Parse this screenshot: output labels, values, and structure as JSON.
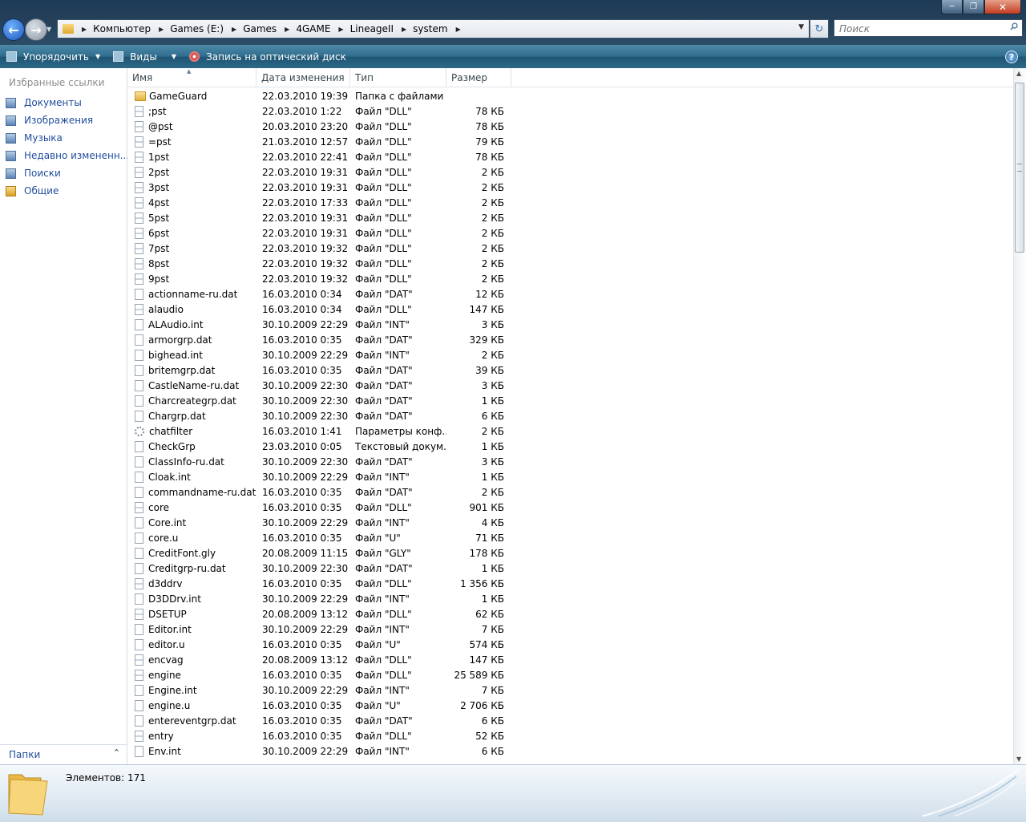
{
  "address": {
    "crumbs": [
      "Компьютер",
      "Games (E:)",
      "Games",
      "4GAME",
      "LineageII",
      "system"
    ]
  },
  "search": {
    "placeholder": "Поиск"
  },
  "toolbar": {
    "organize_label": "Упорядочить",
    "views_label": "Виды",
    "burn_label": "Запись на оптический диск"
  },
  "sidebar": {
    "title": "Избранные ссылки",
    "items": [
      {
        "label": "Документы",
        "icon": "documents-icon"
      },
      {
        "label": "Изображения",
        "icon": "pictures-icon"
      },
      {
        "label": "Музыка",
        "icon": "music-icon"
      },
      {
        "label": "Недавно измененн...",
        "icon": "recent-icon"
      },
      {
        "label": "Поиски",
        "icon": "searches-icon"
      },
      {
        "label": "Общие",
        "icon": "public-folder-icon"
      }
    ],
    "folders_label": "Папки"
  },
  "columns": {
    "name": "Имя",
    "date": "Дата изменения",
    "type": "Тип",
    "size": "Размер"
  },
  "files": [
    {
      "name": "GameGuard",
      "date": "22.03.2010 19:39",
      "type": "Папка с файлами",
      "size": "",
      "icon": "folder"
    },
    {
      "name": ";pst",
      "date": "22.03.2010 1:22",
      "type": "Файл \"DLL\"",
      "size": "78 КБ",
      "icon": "dll"
    },
    {
      "name": "@pst",
      "date": "20.03.2010 23:20",
      "type": "Файл \"DLL\"",
      "size": "78 КБ",
      "icon": "dll"
    },
    {
      "name": "=pst",
      "date": "21.03.2010 12:57",
      "type": "Файл \"DLL\"",
      "size": "79 КБ",
      "icon": "dll"
    },
    {
      "name": "1pst",
      "date": "22.03.2010 22:41",
      "type": "Файл \"DLL\"",
      "size": "78 КБ",
      "icon": "dll"
    },
    {
      "name": "2pst",
      "date": "22.03.2010 19:31",
      "type": "Файл \"DLL\"",
      "size": "2 КБ",
      "icon": "dll"
    },
    {
      "name": "3pst",
      "date": "22.03.2010 19:31",
      "type": "Файл \"DLL\"",
      "size": "2 КБ",
      "icon": "dll"
    },
    {
      "name": "4pst",
      "date": "22.03.2010 17:33",
      "type": "Файл \"DLL\"",
      "size": "2 КБ",
      "icon": "dll"
    },
    {
      "name": "5pst",
      "date": "22.03.2010 19:31",
      "type": "Файл \"DLL\"",
      "size": "2 КБ",
      "icon": "dll"
    },
    {
      "name": "6pst",
      "date": "22.03.2010 19:31",
      "type": "Файл \"DLL\"",
      "size": "2 КБ",
      "icon": "dll"
    },
    {
      "name": "7pst",
      "date": "22.03.2010 19:32",
      "type": "Файл \"DLL\"",
      "size": "2 КБ",
      "icon": "dll"
    },
    {
      "name": "8pst",
      "date": "22.03.2010 19:32",
      "type": "Файл \"DLL\"",
      "size": "2 КБ",
      "icon": "dll"
    },
    {
      "name": "9pst",
      "date": "22.03.2010 19:32",
      "type": "Файл \"DLL\"",
      "size": "2 КБ",
      "icon": "dll"
    },
    {
      "name": "actionname-ru.dat",
      "date": "16.03.2010 0:34",
      "type": "Файл \"DAT\"",
      "size": "12 КБ",
      "icon": "file"
    },
    {
      "name": "alaudio",
      "date": "16.03.2010 0:34",
      "type": "Файл \"DLL\"",
      "size": "147 КБ",
      "icon": "dll"
    },
    {
      "name": "ALAudio.int",
      "date": "30.10.2009 22:29",
      "type": "Файл \"INT\"",
      "size": "3 КБ",
      "icon": "file"
    },
    {
      "name": "armorgrp.dat",
      "date": "16.03.2010 0:35",
      "type": "Файл \"DAT\"",
      "size": "329 КБ",
      "icon": "file"
    },
    {
      "name": "bighead.int",
      "date": "30.10.2009 22:29",
      "type": "Файл \"INT\"",
      "size": "2 КБ",
      "icon": "file"
    },
    {
      "name": "britemgrp.dat",
      "date": "16.03.2010 0:35",
      "type": "Файл \"DAT\"",
      "size": "39 КБ",
      "icon": "file"
    },
    {
      "name": "CastleName-ru.dat",
      "date": "30.10.2009 22:30",
      "type": "Файл \"DAT\"",
      "size": "3 КБ",
      "icon": "file"
    },
    {
      "name": "Charcreategrp.dat",
      "date": "30.10.2009 22:30",
      "type": "Файл \"DAT\"",
      "size": "1 КБ",
      "icon": "file"
    },
    {
      "name": "Chargrp.dat",
      "date": "30.10.2009 22:30",
      "type": "Файл \"DAT\"",
      "size": "6 КБ",
      "icon": "file"
    },
    {
      "name": "chatfilter",
      "date": "16.03.2010 1:41",
      "type": "Параметры конф...",
      "size": "2 КБ",
      "icon": "cfg"
    },
    {
      "name": "CheckGrp",
      "date": "23.03.2010 0:05",
      "type": "Текстовый докум...",
      "size": "1 КБ",
      "icon": "file"
    },
    {
      "name": "ClassInfo-ru.dat",
      "date": "30.10.2009 22:30",
      "type": "Файл \"DAT\"",
      "size": "3 КБ",
      "icon": "file"
    },
    {
      "name": "Cloak.int",
      "date": "30.10.2009 22:29",
      "type": "Файл \"INT\"",
      "size": "1 КБ",
      "icon": "file"
    },
    {
      "name": "commandname-ru.dat",
      "date": "16.03.2010 0:35",
      "type": "Файл \"DAT\"",
      "size": "2 КБ",
      "icon": "file"
    },
    {
      "name": "core",
      "date": "16.03.2010 0:35",
      "type": "Файл \"DLL\"",
      "size": "901 КБ",
      "icon": "dll"
    },
    {
      "name": "Core.int",
      "date": "30.10.2009 22:29",
      "type": "Файл \"INT\"",
      "size": "4 КБ",
      "icon": "file"
    },
    {
      "name": "core.u",
      "date": "16.03.2010 0:35",
      "type": "Файл \"U\"",
      "size": "71 КБ",
      "icon": "file"
    },
    {
      "name": "CreditFont.gly",
      "date": "20.08.2009 11:15",
      "type": "Файл \"GLY\"",
      "size": "178 КБ",
      "icon": "file"
    },
    {
      "name": "Creditgrp-ru.dat",
      "date": "30.10.2009 22:30",
      "type": "Файл \"DAT\"",
      "size": "1 КБ",
      "icon": "file"
    },
    {
      "name": "d3ddrv",
      "date": "16.03.2010 0:35",
      "type": "Файл \"DLL\"",
      "size": "1 356 КБ",
      "icon": "dll"
    },
    {
      "name": "D3DDrv.int",
      "date": "30.10.2009 22:29",
      "type": "Файл \"INT\"",
      "size": "1 КБ",
      "icon": "file"
    },
    {
      "name": "DSETUP",
      "date": "20.08.2009 13:12",
      "type": "Файл \"DLL\"",
      "size": "62 КБ",
      "icon": "dll"
    },
    {
      "name": "Editor.int",
      "date": "30.10.2009 22:29",
      "type": "Файл \"INT\"",
      "size": "7 КБ",
      "icon": "file"
    },
    {
      "name": "editor.u",
      "date": "16.03.2010 0:35",
      "type": "Файл \"U\"",
      "size": "574 КБ",
      "icon": "file"
    },
    {
      "name": "encvag",
      "date": "20.08.2009 13:12",
      "type": "Файл \"DLL\"",
      "size": "147 КБ",
      "icon": "dll"
    },
    {
      "name": "engine",
      "date": "16.03.2010 0:35",
      "type": "Файл \"DLL\"",
      "size": "25 589 КБ",
      "icon": "dll"
    },
    {
      "name": "Engine.int",
      "date": "30.10.2009 22:29",
      "type": "Файл \"INT\"",
      "size": "7 КБ",
      "icon": "file"
    },
    {
      "name": "engine.u",
      "date": "16.03.2010 0:35",
      "type": "Файл \"U\"",
      "size": "2 706 КБ",
      "icon": "file"
    },
    {
      "name": "entereventgrp.dat",
      "date": "16.03.2010 0:35",
      "type": "Файл \"DAT\"",
      "size": "6 КБ",
      "icon": "file"
    },
    {
      "name": "entry",
      "date": "16.03.2010 0:35",
      "type": "Файл \"DLL\"",
      "size": "52 КБ",
      "icon": "dll"
    },
    {
      "name": "Env.int",
      "date": "30.10.2009 22:29",
      "type": "Файл \"INT\"",
      "size": "6 КБ",
      "icon": "file"
    }
  ],
  "status": {
    "count_label": "Элементов: 171"
  }
}
